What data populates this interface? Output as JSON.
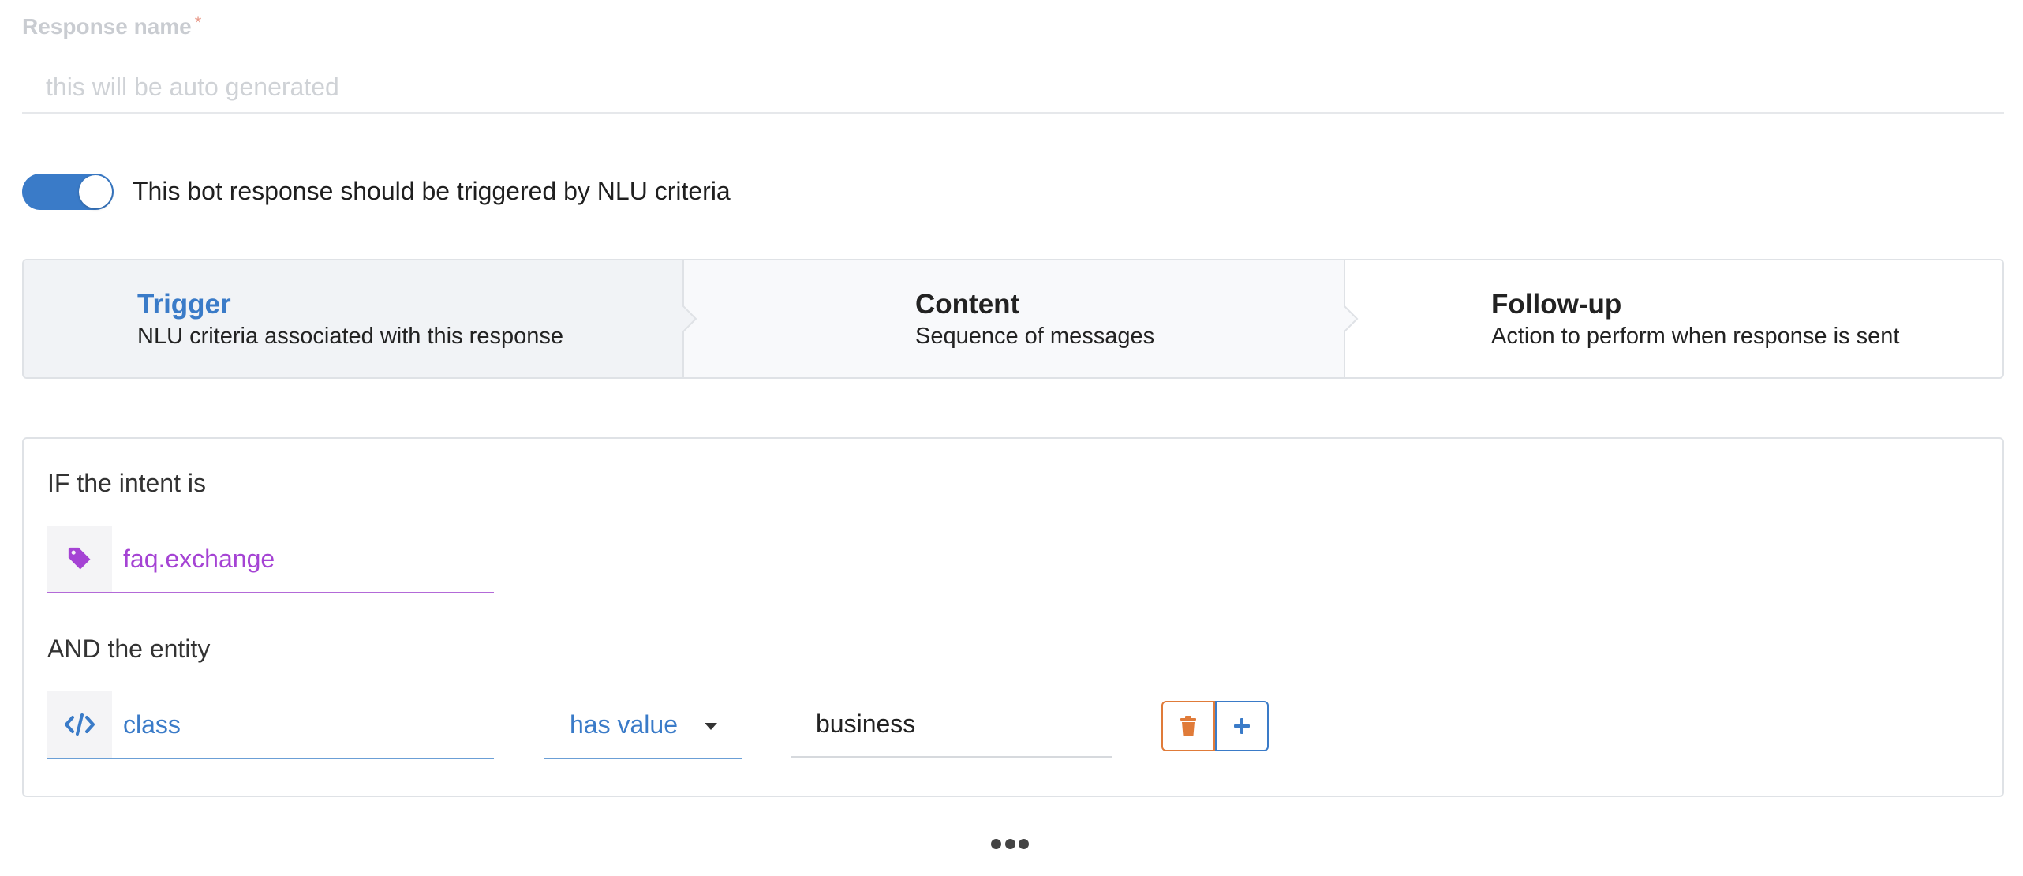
{
  "response_name": {
    "label": "Response name",
    "required_mark": "*",
    "placeholder": "this will be auto generated",
    "value": ""
  },
  "nlu_toggle": {
    "label": "This bot response should be triggered by NLU criteria",
    "on": true,
    "color": "#3a7bc8"
  },
  "steps": [
    {
      "title": "Trigger",
      "subtitle": "NLU criteria associated with this response",
      "active": true
    },
    {
      "title": "Content",
      "subtitle": "Sequence of messages",
      "active": false
    },
    {
      "title": "Follow-up",
      "subtitle": "Action to perform when response is sent",
      "active": false
    }
  ],
  "criteria": {
    "intent_label": "IF the intent is",
    "intent_icon": "tag-icon",
    "intent_value": "faq.exchange",
    "intent_color": "#a543d4",
    "entity_label": "AND the entity",
    "entity_icon": "code-icon",
    "entity_name": "class",
    "operator": "has value",
    "entity_value": "business",
    "delete_icon": "trash-icon",
    "add_icon": "plus-icon",
    "delete_color": "#e07b39",
    "add_color": "#3a7bc8"
  },
  "more_icon": "ellipsis-icon"
}
